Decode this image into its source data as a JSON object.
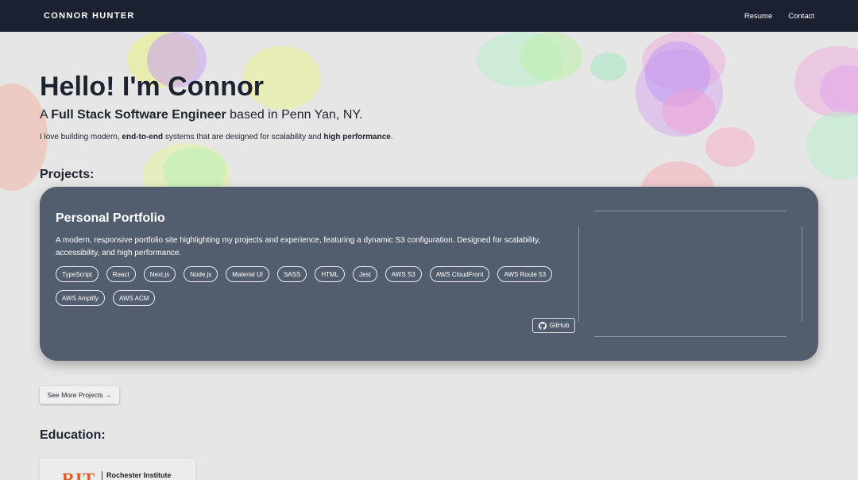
{
  "nav": {
    "brand": "CONNOR HUNTER",
    "links": [
      "Resume",
      "Contact"
    ]
  },
  "hero": {
    "title": "Hello! I'm Connor",
    "subtitle_prefix": "A ",
    "subtitle_bold": "Full Stack Software Engineer",
    "subtitle_suffix": " based in Penn Yan, NY.",
    "desc_1": "I love building modern, ",
    "desc_bold_1": "end-to-end",
    "desc_2": " systems that are designed for scalability and ",
    "desc_bold_2": "high performance",
    "desc_3": "."
  },
  "projects": {
    "heading": "Projects:",
    "card": {
      "title": "Personal Portfolio",
      "description": "A modern, responsive portfolio site highlighting my projects and experience, featuring a dynamic S3 configuration. Designed for scalability, accessibility, and high performance.",
      "tags": [
        "TypeScript",
        "React",
        "Next.js",
        "Node.js",
        "Material UI",
        "SASS",
        "HTML",
        "Jest",
        "AWS S3",
        "AWS CloudFront",
        "AWS Route 53",
        "AWS Amplify",
        "AWS ACM"
      ],
      "github_label": "GitHub"
    },
    "more_label": "See More Projects →"
  },
  "education": {
    "heading": "Education:",
    "logo_text": "RIT",
    "school_name": "Rochester Institute"
  },
  "colors": {
    "navbar": "#1b2130",
    "background": "#e6e6e6",
    "card": "#525e6e",
    "text": "#1d2430",
    "rit_orange": "#e05a22"
  }
}
